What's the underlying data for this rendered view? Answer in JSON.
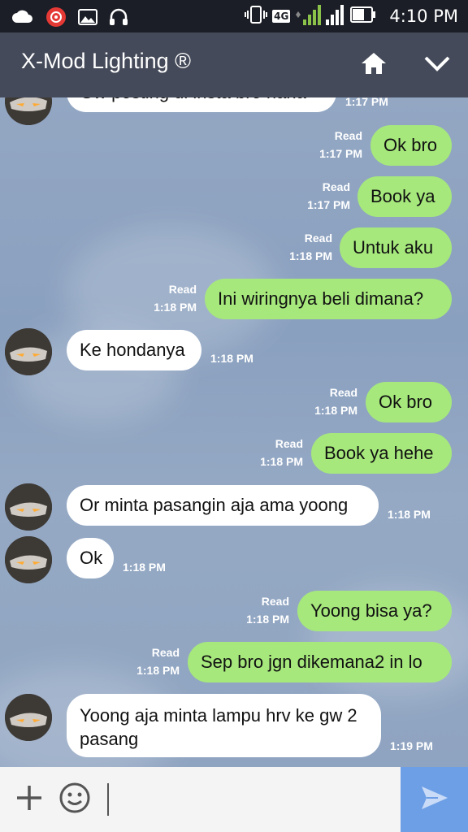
{
  "status_bar": {
    "time": "4:10 PM",
    "network_badge": "4G",
    "sim1": "1",
    "sim2": "2",
    "icons": [
      "cloud-icon",
      "recorder-icon",
      "image-icon",
      "headset-icon",
      "vibrate-icon",
      "signal-icon",
      "battery-icon"
    ]
  },
  "header": {
    "title": "X-Mod Lighting ®",
    "icons": [
      "home-icon",
      "chevron-down-icon"
    ]
  },
  "chat": {
    "messages": [
      {
        "dir": "in",
        "text": "Gw posting di insta bro haha",
        "time": "1:17 PM",
        "read": ""
      },
      {
        "dir": "out",
        "text": "Ok bro",
        "time": "1:17 PM",
        "read": "Read"
      },
      {
        "dir": "out",
        "text": "Book ya",
        "time": "1:17 PM",
        "read": "Read"
      },
      {
        "dir": "out",
        "text": "Untuk aku",
        "time": "1:18 PM",
        "read": "Read"
      },
      {
        "dir": "out",
        "text": "Ini wiringnya beli dimana?",
        "time": "1:18 PM",
        "read": "Read"
      },
      {
        "dir": "in",
        "text": "Ke hondanya",
        "time": "1:18 PM",
        "read": ""
      },
      {
        "dir": "out",
        "text": "Ok bro",
        "time": "1:18 PM",
        "read": "Read"
      },
      {
        "dir": "out",
        "text": "Book ya hehe",
        "time": "1:18 PM",
        "read": "Read"
      },
      {
        "dir": "in",
        "text": "Or minta pasangin aja ama yoong",
        "time": "1:18 PM",
        "read": ""
      },
      {
        "dir": "in",
        "text": "Ok",
        "time": "1:18 PM",
        "read": ""
      },
      {
        "dir": "out",
        "text": "Yoong bisa ya?",
        "time": "1:18 PM",
        "read": "Read"
      },
      {
        "dir": "out",
        "text": "Sep bro jgn dikemana2 in lo",
        "time": "1:18 PM",
        "read": "Read"
      },
      {
        "dir": "in",
        "text": "Yoong aja minta lampu hrv ke gw 2 pasang",
        "time": "1:19 PM",
        "read": ""
      }
    ]
  },
  "input_bar": {
    "icons": [
      "plus-icon",
      "emoji-icon",
      "send-icon"
    ],
    "placeholder": ""
  },
  "colors": {
    "outgoing_bubble": "#a6e87c",
    "incoming_bubble": "#ffffff",
    "header_bg": "#444a59",
    "status_bg": "#1b1e26",
    "send_button": "#6d9fe6"
  }
}
